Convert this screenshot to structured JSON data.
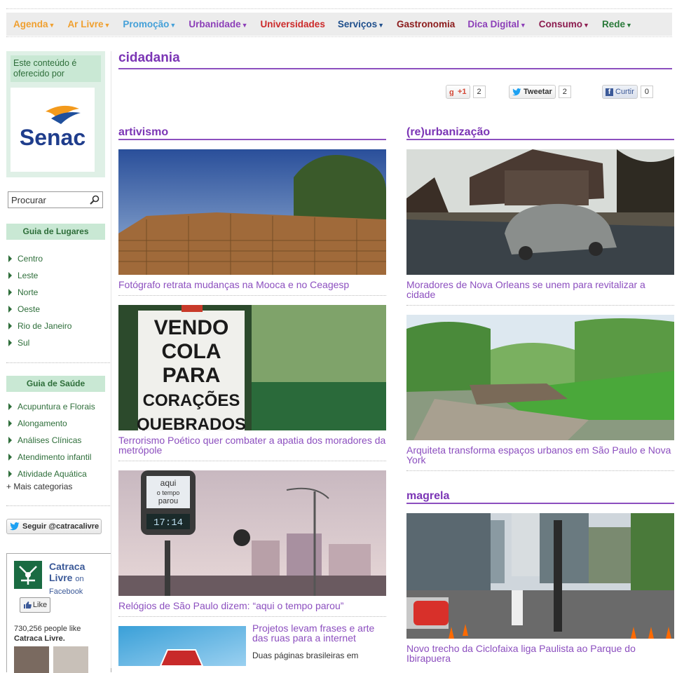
{
  "nav": [
    {
      "label": "Agenda",
      "color": "#f0a030",
      "caret": true
    },
    {
      "label": "Ar Livre",
      "color": "#f0a030",
      "caret": true
    },
    {
      "label": "Promoção",
      "color": "#44a0d8",
      "caret": true
    },
    {
      "label": "Urbanidade",
      "color": "#8c3fb8",
      "caret": true
    },
    {
      "label": "Universidades",
      "color": "#cc2a2a",
      "caret": false
    },
    {
      "label": "Serviços",
      "color": "#1f4f8c",
      "caret": true
    },
    {
      "label": "Gastronomia",
      "color": "#8c1c1c",
      "caret": false
    },
    {
      "label": "Dica Digital",
      "color": "#8c3fb8",
      "caret": true
    },
    {
      "label": "Consumo",
      "color": "#8c1c4f",
      "caret": true
    },
    {
      "label": "Rede",
      "color": "#2a7a3a",
      "caret": true
    }
  ],
  "sidebar": {
    "sponsor_label": "Este conteúdo é oferecido por",
    "sponsor_logo": "Senac",
    "search_value": "Procurar",
    "guide_places": {
      "title": "Guia de Lugares",
      "items": [
        "Centro",
        "Leste",
        "Norte",
        "Oeste",
        "Rio de Janeiro",
        "Sul"
      ]
    },
    "guide_health": {
      "title": "Guia de Saúde",
      "items": [
        "Acupuntura e Florais",
        "Alongamento",
        "Análises Clínicas",
        "Atendimento infantil",
        "Atividade Aquática"
      ],
      "more": "+ Mais categorias"
    },
    "follow_label": "Seguir @catracalivre",
    "facebook": {
      "name": "Catraca Livre",
      "on": "on",
      "network": "Facebook",
      "like_label": "Like",
      "count_text": "730,256 people like",
      "page_name": "Catraca Livre."
    }
  },
  "main": {
    "title": "cidadania",
    "share": {
      "gplus_label": "+1",
      "gplus_count": "2",
      "tweet_label": "Tweetar",
      "tweet_count": "2",
      "fb_label": "Curtir",
      "fb_count": "0"
    },
    "sections": {
      "artivismo": "artivismo",
      "reurbanizacao": "(re)urbanização",
      "magrela": "magrela"
    },
    "articles": {
      "a1": "Fotógrafo retrata mudanças na Mooca e no Ceagesp",
      "a2": "Terrorismo Poético quer combater a apatia dos moradores da metrópole",
      "a3": "Relógios de São Paulo dizem: “aqui o tempo parou”",
      "a4": "Projetos levam frases e arte das ruas para a internet",
      "a4_desc": "Duas páginas brasileiras em",
      "b1": "Moradores de Nova Orleans se unem para revitalizar a cidade",
      "b2": "Arquiteta transforma espaços urbanos em São Paulo e Nova York",
      "c1": "Novo trecho da Ciclofaixa liga Paulista ao Parque do Ibirapuera"
    },
    "sign_text": [
      "VENDO",
      "COLA",
      "PARA",
      "CORAÇÕES",
      "QUEBRADOS"
    ],
    "clock_text": {
      "line1": "aqui",
      "line2": "o tempo",
      "line3": "parou",
      "time": "17:14"
    }
  }
}
